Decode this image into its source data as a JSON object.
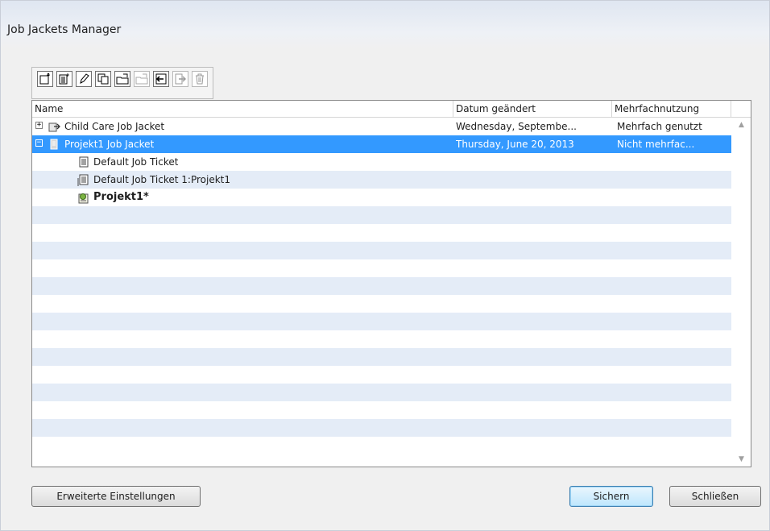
{
  "window": {
    "title": "Job Jackets Manager"
  },
  "toolbar": {
    "buttons": [
      {
        "icon": "new-jacket-icon",
        "enabled": true
      },
      {
        "icon": "new-ticket-icon",
        "enabled": true
      },
      {
        "icon": "edit-pencil-icon",
        "enabled": true
      },
      {
        "icon": "duplicate-icon",
        "enabled": true
      },
      {
        "icon": "open-folder-icon",
        "enabled": true
      },
      {
        "icon": "open-folder-icon",
        "enabled": false
      },
      {
        "icon": "import-icon",
        "enabled": true
      },
      {
        "icon": "export-icon",
        "enabled": false
      },
      {
        "icon": "trash-icon",
        "enabled": false
      }
    ]
  },
  "list": {
    "columns": {
      "name": "Name",
      "date": "Datum geändert",
      "usage": "Mehrfachnutzung"
    },
    "rows": [
      {
        "expander": "+",
        "icon": "job-jacket-icon",
        "name": "Child Care Job Jacket",
        "date": "Wednesday, Septembe...",
        "usage": "Mehrfach genutzt"
      },
      {
        "expander": "−",
        "icon": "job-jacket-icon",
        "name": "Projekt1 Job Jacket",
        "date": "Thursday, June 20, 2013",
        "usage": "Nicht mehrfac..."
      },
      {
        "icon": "job-ticket-icon",
        "name": "Default Job Ticket"
      },
      {
        "icon": "job-ticket-icon",
        "name": "Default Job Ticket 1:Projekt1"
      },
      {
        "icon": "project-icon",
        "name": "Projekt1*"
      }
    ]
  },
  "buttons": {
    "advanced": "Erweiterte Einstellungen",
    "save": "Sichern",
    "close": "Schließen"
  },
  "colors": {
    "selection": "#3399ff",
    "alt_row": "#e4ecf7"
  }
}
